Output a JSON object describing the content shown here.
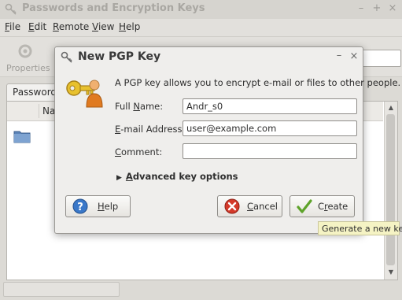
{
  "main_window": {
    "title": "Passwords and Encryption Keys",
    "menu": [
      {
        "label": "File",
        "mnemonic": "F",
        "rest": "ile"
      },
      {
        "label": "Edit",
        "mnemonic": "E",
        "rest": "dit"
      },
      {
        "label": "Remote",
        "mnemonic": "R",
        "rest": "emote"
      },
      {
        "label": "View",
        "mnemonic": "V",
        "rest": "iew"
      },
      {
        "label": "Help",
        "mnemonic": "H",
        "rest": "elp"
      }
    ],
    "toolbar": {
      "properties_label": "Properties"
    },
    "tab_label": "Passwords",
    "column_header": "Na"
  },
  "dialog": {
    "title": "New PGP Key",
    "intro": "A PGP key allows you to encrypt e-mail or files to other people.",
    "fields": {
      "full_name": {
        "label_mnemonic": "N",
        "label_before": "Full ",
        "label_after": "ame:",
        "value": "Andr_s0"
      },
      "email": {
        "label_mnemonic": "E",
        "label_after": "-mail Address:",
        "value": "user@example.com"
      },
      "comment": {
        "label_mnemonic": "C",
        "label_after": "omment:",
        "value": ""
      }
    },
    "advanced": {
      "mnemonic": "A",
      "rest": "dvanced key options"
    },
    "buttons": {
      "help": {
        "mnemonic": "H",
        "rest": "elp"
      },
      "cancel": {
        "mnemonic": "C",
        "rest": "ancel"
      },
      "create": {
        "mnemonic": "r",
        "before": "C",
        "rest": "eate"
      }
    }
  },
  "tooltip": "Generate a new key",
  "colors": {
    "help_button_icon": "#3a78c9",
    "cancel_button_icon": "#d43a2a",
    "create_button_icon": "#5ea32a",
    "tooltip_bg": "#f5f3c4"
  }
}
